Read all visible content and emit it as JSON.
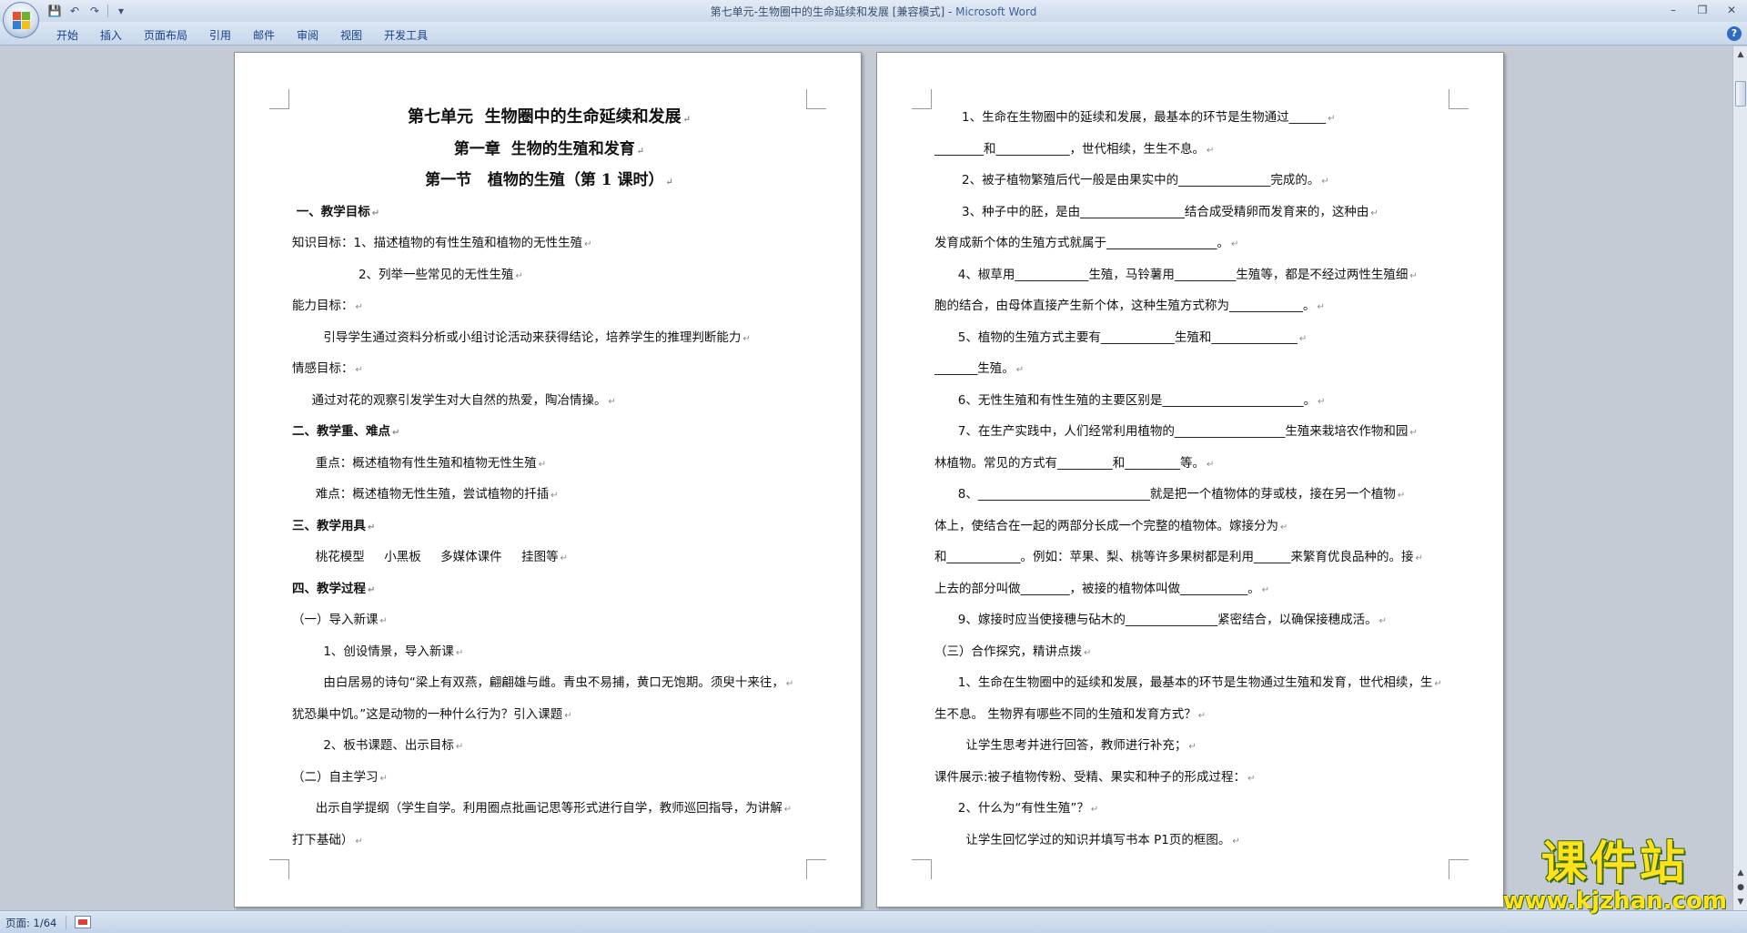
{
  "window": {
    "title_doc": "第七单元-生物圈中的生命延续和发展 [兼容模式] - ",
    "title_app": "Microsoft Word",
    "controls": [
      "–",
      "❐",
      "✕"
    ]
  },
  "quick_access": {
    "save": "💾",
    "undo": "↶",
    "redo": "↷",
    "customize": "▾"
  },
  "ribbon": {
    "tabs": [
      "开始",
      "插入",
      "页面布局",
      "引用",
      "邮件",
      "审阅",
      "视图",
      "开发工具"
    ],
    "help": "?"
  },
  "page1": {
    "lines": [
      {
        "text": "第七单元  生物圈中的生命延续和发展",
        "style": "h1 center"
      },
      {
        "text": "第一章  生物的生殖和发育",
        "style": "h2 center"
      },
      {
        "text": "第一节   植物的生殖（第 1 课时）",
        "style": "h2 center"
      },
      {
        "text": " 一、教学目标",
        "style": "sec"
      },
      {
        "text": "知识目标：1、描述植物的有性生殖和植物的无性生殖",
        "style": ""
      },
      {
        "text": "                 2、列举一些常见的无性生殖",
        "style": ""
      },
      {
        "text": "能力目标：",
        "style": ""
      },
      {
        "text": "        引导学生通过资料分析或小组讨论活动来获得结论，培养学生的推理判断能力",
        "style": ""
      },
      {
        "text": "情感目标：",
        "style": ""
      },
      {
        "text": "     通过对花的观察引发学生对大自然的热爱，陶冶情操。",
        "style": ""
      },
      {
        "text": "二、教学重、难点",
        "style": "sec"
      },
      {
        "text": "      重点：概述植物有性生殖和植物无性生殖",
        "style": ""
      },
      {
        "text": "      难点：概述植物无性生殖，尝试植物的扦插",
        "style": ""
      },
      {
        "text": "三、教学用具",
        "style": "sec"
      },
      {
        "text": "      桃花模型     小黑板     多媒体课件     挂图等",
        "style": ""
      },
      {
        "text": "四、教学过程",
        "style": "sec"
      },
      {
        "text": "（一）导入新课",
        "style": ""
      },
      {
        "text": "        1、创设情景，导入新课",
        "style": ""
      },
      {
        "text": "        由白居易的诗句“梁上有双燕，翩翩雄与雌。青虫不易捕，黄口无饱期。须臾十来往，",
        "style": ""
      },
      {
        "text": "犹恐巢中饥。”这是动物的一种什么行为？引入课题",
        "style": ""
      },
      {
        "text": "        2、板书课题、出示目标",
        "style": ""
      },
      {
        "text": "（二）自主学习",
        "style": ""
      },
      {
        "text": "      出示自学提纲（学生自学。利用圈点批画记思等形式进行自学，教师巡回指导，为讲解",
        "style": ""
      },
      {
        "text": "打下基础）",
        "style": ""
      }
    ]
  },
  "page2": {
    "lines": [
      {
        "text": "       1、生命在生物圈中的延续和发展，最基本的环节是生物通过______",
        "style": ""
      },
      {
        "text": "________和____________，世代相续，生生不息。",
        "style": ""
      },
      {
        "text": "       2、被子植物繁殖后代一般是由果实中的_______________完成的。",
        "style": ""
      },
      {
        "text": "       3、种子中的胚，是由_________________结合成受精卵而发育来的，这种由",
        "style": ""
      },
      {
        "text": "发育成新个体的生殖方式就属于__________________。",
        "style": ""
      },
      {
        "text": "      4、椒草用____________生殖，马铃薯用__________生殖等，都是不经过两性生殖细",
        "style": ""
      },
      {
        "text": "胞的结合，由母体直接产生新个体，这种生殖方式称为____________。",
        "style": ""
      },
      {
        "text": "      5、植物的生殖方式主要有____________生殖和______________",
        "style": ""
      },
      {
        "text": "_______生殖。",
        "style": ""
      },
      {
        "text": "      6、无性生殖和有性生殖的主要区别是_______________________。",
        "style": ""
      },
      {
        "text": "      7、在生产实践中，人们经常利用植物的__________________生殖来栽培农作物和园",
        "style": ""
      },
      {
        "text": "林植物。常见的方式有_________和_________等。",
        "style": ""
      },
      {
        "text": "      8、____________________________就是把一个植物体的芽或枝，接在另一个植物",
        "style": ""
      },
      {
        "text": "体上，使结合在一起的两部分长成一个完整的植物体。嫁接分为",
        "style": ""
      },
      {
        "text": "和____________。例如：苹果、梨、桃等许多果树都是利用______来繁育优良品种的。接",
        "style": ""
      },
      {
        "text": "上去的部分叫做________，被接的植物体叫做___________。",
        "style": ""
      },
      {
        "text": "      9、嫁接时应当使接穗与砧木的_______________紧密结合，以确保接穗成活。",
        "style": ""
      },
      {
        "text": "（三）合作探究，精讲点拨",
        "style": ""
      },
      {
        "text": "      1、生命在生物圈中的延续和发展，最基本的环节是生物通过生殖和发育，世代相续，生",
        "style": ""
      },
      {
        "text": "生不息。 生物界有哪些不同的生殖和发育方式？",
        "style": ""
      },
      {
        "text": "        让学生思考并进行回答，教师进行补充；",
        "style": ""
      },
      {
        "text": "课件展示:被子植物传粉、受精、果实和种子的形成过程：",
        "style": ""
      },
      {
        "text": "      2、什么为“有性生殖”？",
        "style": ""
      },
      {
        "text": "        让学生回忆学过的知识并填写书本 P1页的框图。",
        "style": ""
      }
    ]
  },
  "paragraph_mark": "↵",
  "status": {
    "page_count": "页面: 1/64"
  },
  "watermark": {
    "title": "课件站",
    "url": "www.kjzhan.com"
  }
}
